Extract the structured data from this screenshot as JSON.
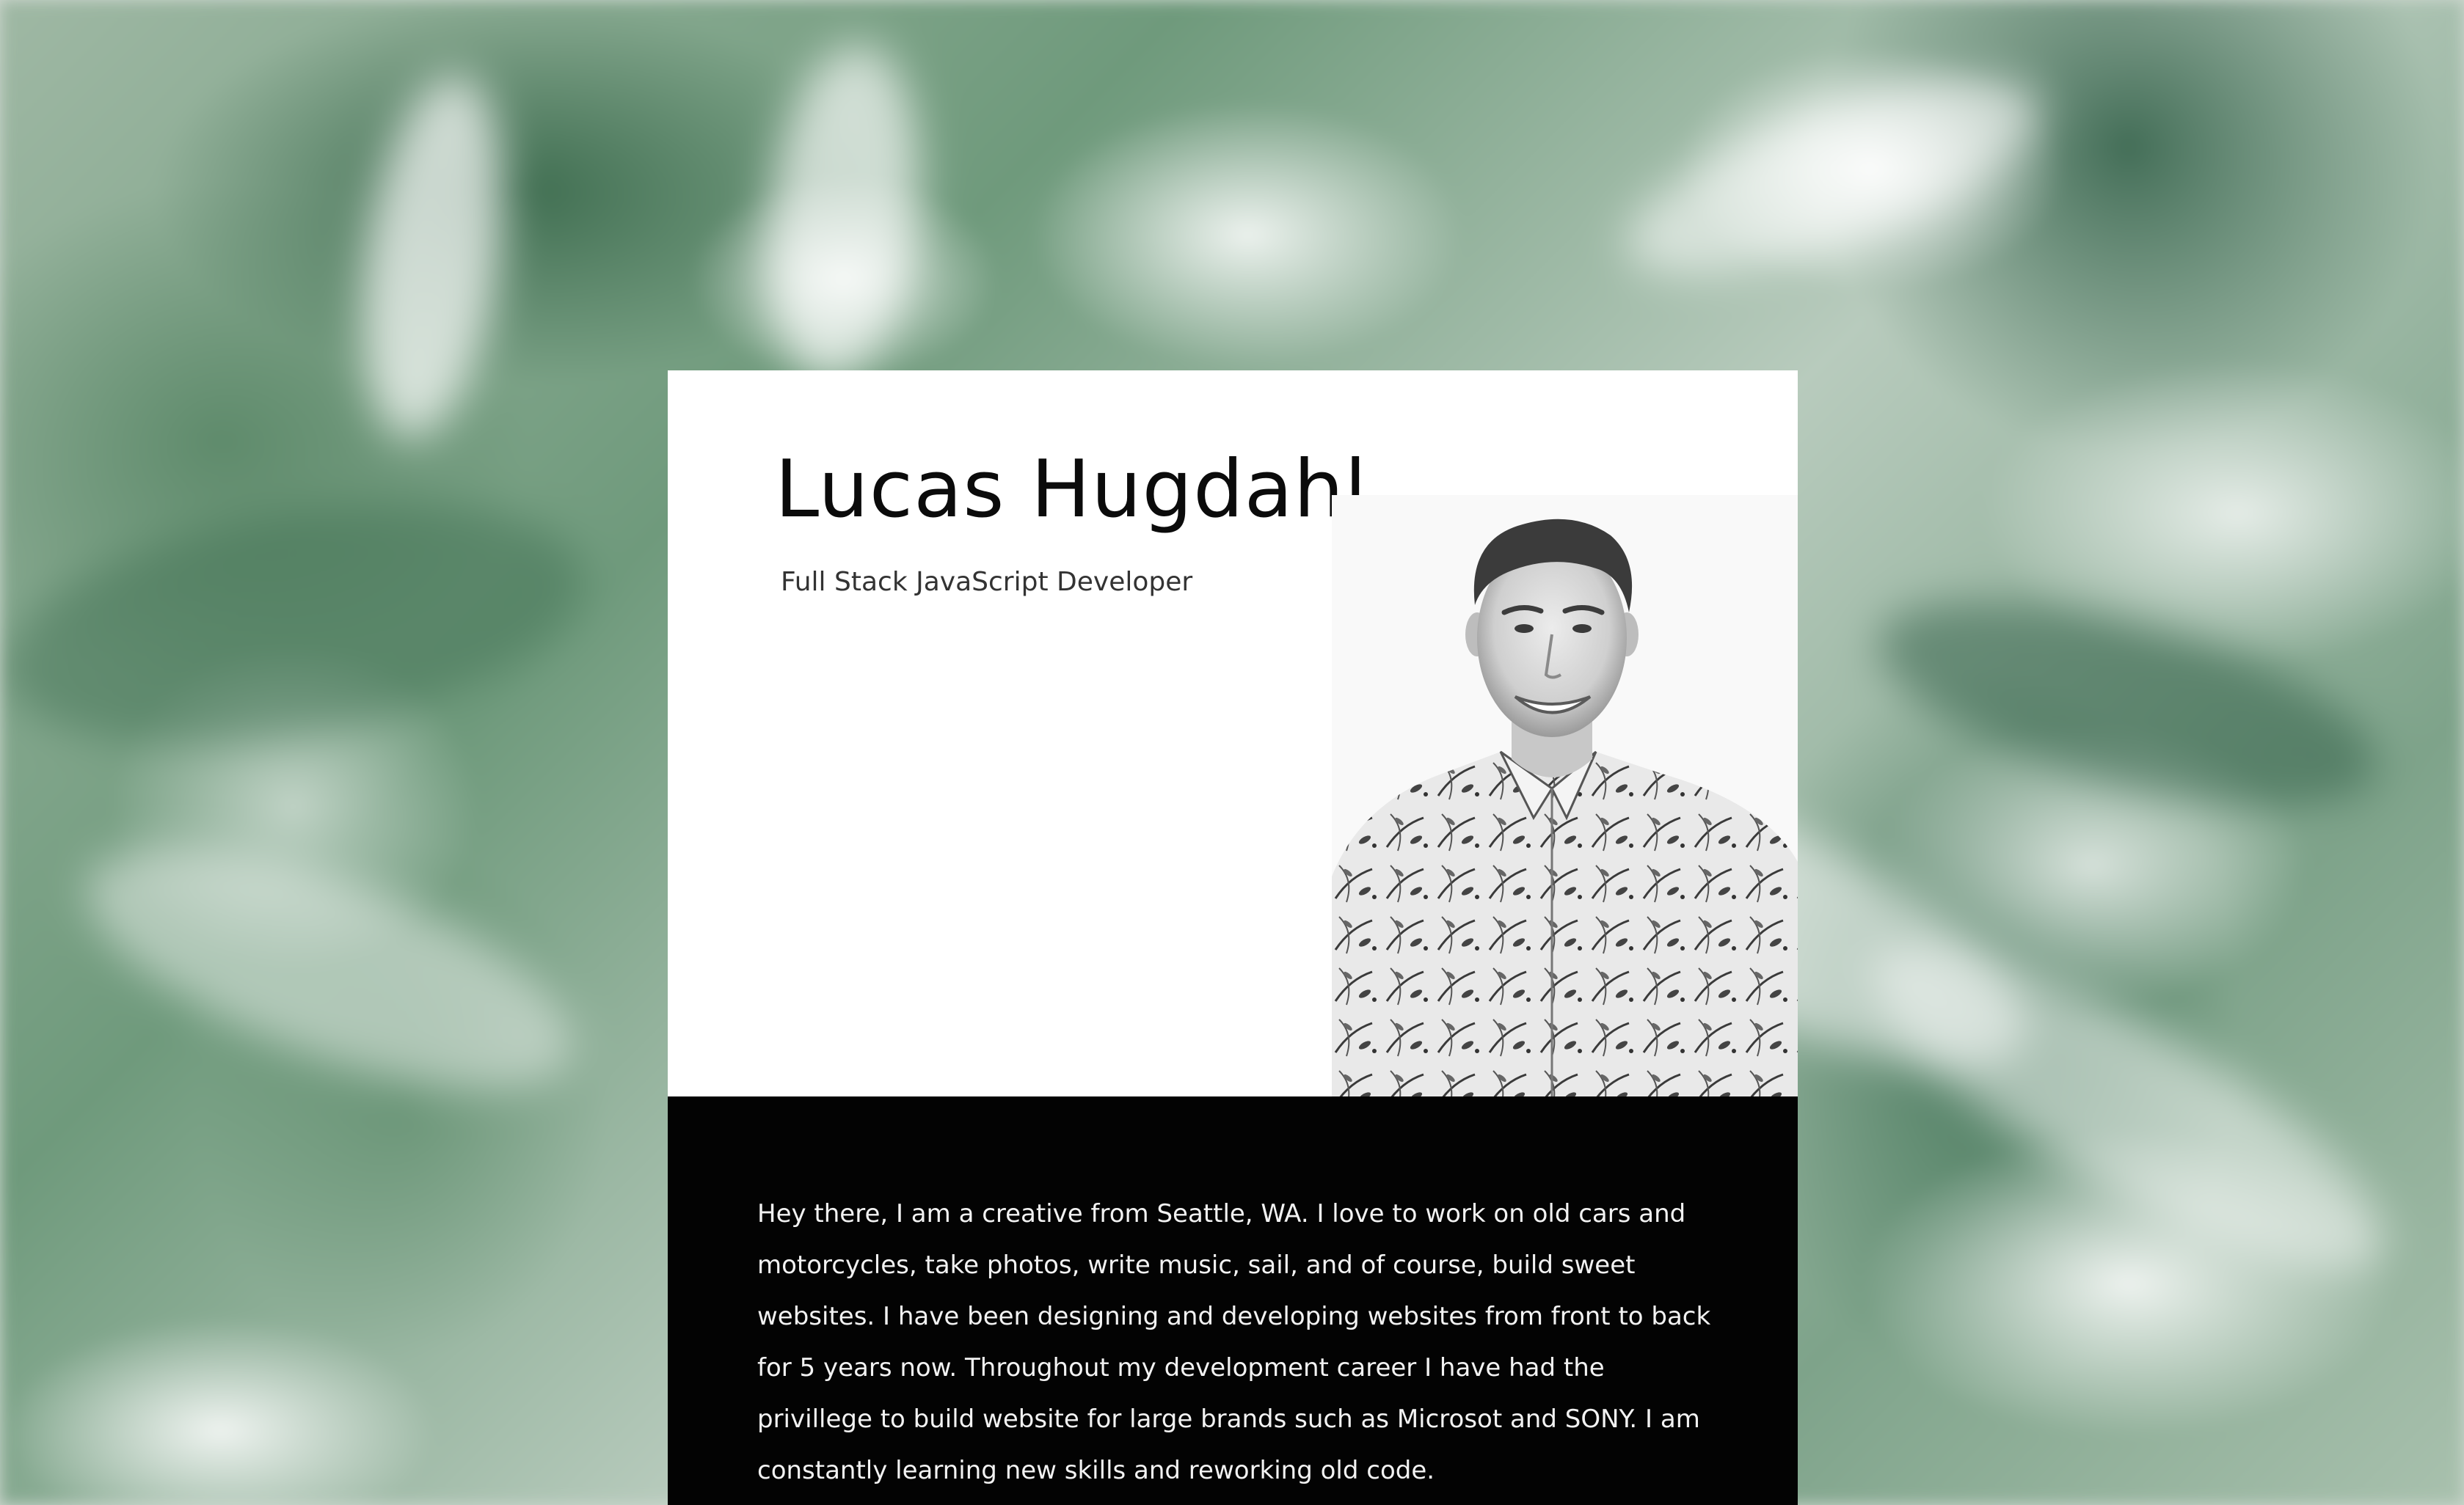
{
  "profile": {
    "name": "Lucas Hugdahl",
    "title": "Full Stack JavaScript Developer",
    "bio": "Hey there, I am a creative from Seattle, WA. I love to work on old cars and motorcycles, take photos, write music, sail, and of course, build sweet websites. I have been designing and developing websites from front to back for 5 years now. Throughout my development career I have had the privillege to build website for large brands such as Microsot and SONY. I am constantly learning new skills and reworking old code."
  },
  "colors": {
    "card_top_background": "#ffffff",
    "card_bottom_background": "#030303",
    "name_text": "#0b0b0b",
    "bio_text": "#f2f2f2",
    "background_leaf_green": "#4f7d5e"
  },
  "images": {
    "background": "blurred-monstera-leaves",
    "portrait": "black-and-white-portrait"
  }
}
